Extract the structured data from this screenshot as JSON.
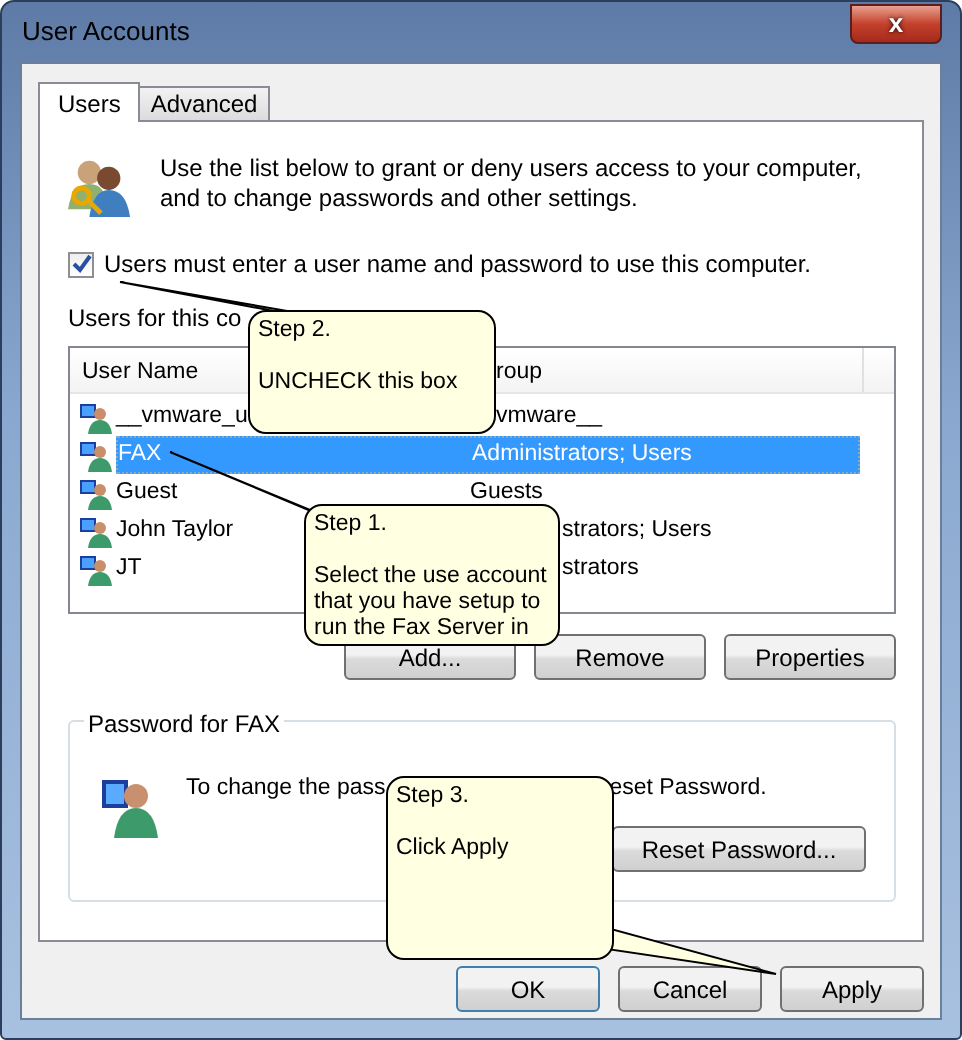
{
  "window": {
    "title": "User Accounts",
    "close": "x"
  },
  "tabs": [
    {
      "label": "Users",
      "selected": true
    },
    {
      "label": "Advanced",
      "selected": false
    }
  ],
  "intro": "Use the list below to grant or deny users access to your computer, and to change passwords and other settings.",
  "require_login": {
    "label": "Users must enter a user name and password to use this computer.",
    "checked": true
  },
  "users_label": "Users for this co",
  "table": {
    "columns": [
      "User Name",
      "roup"
    ],
    "rows": [
      {
        "name": "__vmware_u",
        "group": "vmware__",
        "selected": false
      },
      {
        "name": "FAX",
        "group": "Administrators; Users",
        "selected": true
      },
      {
        "name": "Guest",
        "group": "Guests",
        "selected": false
      },
      {
        "name": "John Taylor",
        "group": "strators; Users",
        "selected": false
      },
      {
        "name": "JT",
        "group": "strators",
        "selected": false
      }
    ]
  },
  "list_buttons": [
    "Add...",
    "Remove",
    "Properties"
  ],
  "password": {
    "title": "Password for FAX",
    "text_before": "To change the pass",
    "text_after": "eset Password.",
    "button": "Reset Password..."
  },
  "buttons": [
    "OK",
    "Cancel",
    "Apply"
  ],
  "callouts": [
    {
      "title": "Step 2.",
      "text": "UNCHECK this box"
    },
    {
      "title": "Step 1.",
      "text": "Select the use account that you have setup to run the Fax Server in"
    },
    {
      "title": "Step 3.",
      "text": "Click Apply"
    }
  ]
}
